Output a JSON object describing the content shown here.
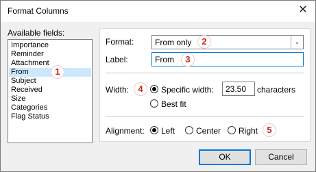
{
  "window": {
    "title": "Format Columns",
    "close_glyph": "✕"
  },
  "available_fields": {
    "label": "Available fields:",
    "items": [
      "Importance",
      "Reminder",
      "Attachment",
      "From",
      "Subject",
      "Received",
      "Size",
      "Categories",
      "Flag Status"
    ],
    "selected": "From"
  },
  "format": {
    "label": "Format:",
    "value": "From only",
    "arrow": "⌄"
  },
  "label_field": {
    "label": "Label:",
    "value": "From"
  },
  "width": {
    "label": "Width:",
    "specific_label": "Specific width:",
    "specific_value": "23.50",
    "units": "characters",
    "best_fit_label": "Best fit",
    "selected": "specific"
  },
  "alignment": {
    "label": "Alignment:",
    "options": [
      "Left",
      "Center",
      "Right"
    ],
    "selected": "Left"
  },
  "buttons": {
    "ok": "OK",
    "cancel": "Cancel"
  },
  "badges": [
    "1",
    "2",
    "3",
    "4",
    "5"
  ],
  "colors": {
    "badge_text": "#d0201a",
    "selection": "#cce8ff",
    "focus_border": "#0078d7"
  }
}
